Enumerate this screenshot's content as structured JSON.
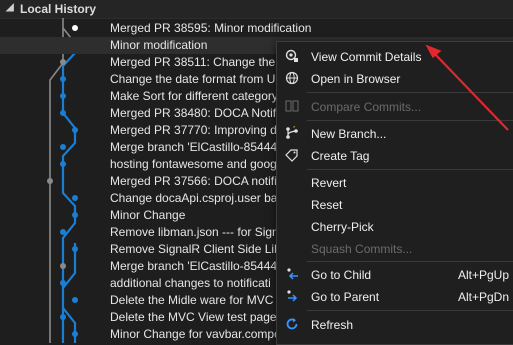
{
  "panel": {
    "title": "Local History"
  },
  "commits": [
    "Merged PR 38595: Minor modification",
    "Minor modification",
    "Merged PR 38511: Change the d",
    "Change the date format from U",
    "Make Sort for different category",
    "Merged PR 38480: DOCA Notifica",
    "Merged PR 37770: Improving dc",
    "Merge branch 'ElCastillo-854448",
    "hosting fontawesome and goog",
    "Merged PR 37566: DOCA notific",
    "Change docaApi.csproj.user ba",
    "Minor Change",
    "Remove libman.json --- for Sign",
    "Remove SignalR Client Side Lib",
    "Merge branch 'ElCastillo-854448",
    "additional changes to notificati",
    "Delete the Midle ware for MVC v",
    "Delete the MVC View test page:",
    "Minor Change for vavbar.compone"
  ],
  "selected_index": 1,
  "context_menu": {
    "items": [
      {
        "id": "view-commit-details",
        "label": "View Commit Details",
        "icon": "commit-details-icon",
        "enabled": true
      },
      {
        "id": "open-in-browser",
        "label": "Open in Browser",
        "icon": "globe-icon",
        "enabled": true
      },
      {
        "id": "compare-commits",
        "label": "Compare Commits...",
        "icon": "compare-icon",
        "enabled": false
      },
      {
        "id": "new-branch",
        "label": "New Branch...",
        "icon": "branch-icon",
        "enabled": true
      },
      {
        "id": "create-tag",
        "label": "Create Tag",
        "icon": "tag-icon",
        "enabled": true
      },
      {
        "id": "revert",
        "label": "Revert",
        "icon": "",
        "enabled": true
      },
      {
        "id": "reset",
        "label": "Reset",
        "icon": "",
        "enabled": true
      },
      {
        "id": "cherry-pick",
        "label": "Cherry-Pick",
        "icon": "",
        "enabled": true
      },
      {
        "id": "squash-commits",
        "label": "Squash Commits...",
        "icon": "",
        "enabled": false
      },
      {
        "id": "go-to-child",
        "label": "Go to Child",
        "icon": "go-to-child-icon",
        "enabled": true,
        "shortcut": "Alt+PgUp"
      },
      {
        "id": "go-to-parent",
        "label": "Go to Parent",
        "icon": "go-to-parent-icon",
        "enabled": true,
        "shortcut": "Alt+PgDn"
      },
      {
        "id": "refresh",
        "label": "Refresh",
        "icon": "refresh-icon",
        "enabled": true
      }
    ]
  },
  "colors": {
    "branch": "#1a7fd4",
    "node": "#ffffff",
    "merge_line": "#8a8a8a",
    "annotation_arrow": "#e0282e"
  }
}
